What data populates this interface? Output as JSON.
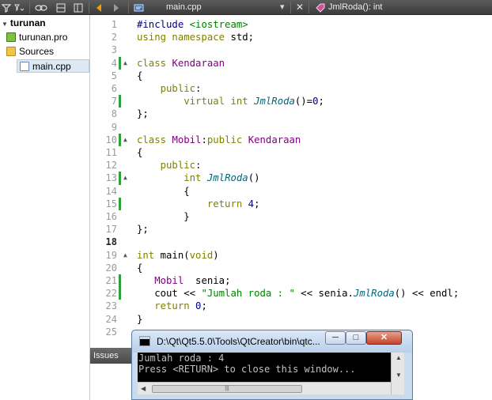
{
  "toolbar": {
    "icons": [
      "filter-icon",
      "link-icon",
      "split-icon",
      "expand-icon",
      "back-arrow-icon",
      "forward-arrow-icon"
    ],
    "file_tab": "main.cpp",
    "symbol_tab": "JmlRoda(): int",
    "close_glyph": "✕",
    "dropdown_glyph": "▾"
  },
  "tree": {
    "project": "turunan",
    "pro_file": "turunan.pro",
    "sources_folder": "Sources",
    "source_file": "main.cpp"
  },
  "editor": {
    "current_line": 18,
    "lines": [
      {
        "n": "1",
        "changed": false,
        "fold": "",
        "html": "<span class='pp'>#include</span> <span class='str'>&lt;iostream&gt;</span>"
      },
      {
        "n": "2",
        "changed": false,
        "fold": "",
        "html": "<span class='kw'>using namespace</span> std;"
      },
      {
        "n": "3",
        "changed": false,
        "fold": "",
        "html": ""
      },
      {
        "n": "4",
        "changed": true,
        "fold": "▲",
        "html": "<span class='kw'>class</span> <span class='ty'>Kendaraan</span>"
      },
      {
        "n": "5",
        "changed": false,
        "fold": "",
        "html": "{"
      },
      {
        "n": "6",
        "changed": false,
        "fold": "",
        "html": "    <span class='kw'>public</span>:"
      },
      {
        "n": "7",
        "changed": true,
        "fold": "",
        "html": "        <span class='kw'>virtual int</span> <span class='fn'>JmlRoda</span>()=<span class='num'>0</span>;"
      },
      {
        "n": "8",
        "changed": false,
        "fold": "",
        "html": "};"
      },
      {
        "n": "9",
        "changed": false,
        "fold": "",
        "html": ""
      },
      {
        "n": "10",
        "changed": true,
        "fold": "▲",
        "html": "<span class='kw'>class</span> <span class='ty'>Mobil</span>:<span class='kw'>public</span> <span class='ty'>Kendaraan</span>"
      },
      {
        "n": "11",
        "changed": false,
        "fold": "",
        "html": "{"
      },
      {
        "n": "12",
        "changed": false,
        "fold": "",
        "html": "    <span class='kw'>public</span>:"
      },
      {
        "n": "13",
        "changed": true,
        "fold": "▲",
        "html": "        <span class='kw'>int</span> <span class='fn'>JmlRoda</span>()"
      },
      {
        "n": "14",
        "changed": false,
        "fold": "",
        "html": "        {"
      },
      {
        "n": "15",
        "changed": true,
        "fold": "",
        "html": "            <span class='kw'>return</span> <span class='num'>4</span>;"
      },
      {
        "n": "16",
        "changed": false,
        "fold": "",
        "html": "        }"
      },
      {
        "n": "17",
        "changed": false,
        "fold": "",
        "html": "};"
      },
      {
        "n": "18",
        "changed": false,
        "fold": "",
        "html": ""
      },
      {
        "n": "19",
        "changed": false,
        "fold": "▲",
        "html": "<span class='kw'>int</span> main(<span class='kw'>void</span>)"
      },
      {
        "n": "20",
        "changed": false,
        "fold": "",
        "html": "{"
      },
      {
        "n": "21",
        "changed": true,
        "fold": "",
        "html": "   <span class='ty'>Mobil</span>  senia;"
      },
      {
        "n": "22",
        "changed": true,
        "fold": "",
        "html": "   cout &lt;&lt; <span class='str'>\"Jumlah roda : \"</span> &lt;&lt; senia.<span class='fn'>JmlRoda</span>() &lt;&lt; endl;"
      },
      {
        "n": "23",
        "changed": false,
        "fold": "",
        "html": "   <span class='kw'>return</span> <span class='num'>0</span>;"
      },
      {
        "n": "24",
        "changed": false,
        "fold": "",
        "html": "}"
      },
      {
        "n": "25",
        "changed": false,
        "fold": "",
        "html": ""
      }
    ]
  },
  "issues": {
    "label": "Issues"
  },
  "console": {
    "title": "D:\\Qt\\Qt5.5.0\\Tools\\QtCreator\\bin\\qtc...",
    "minimize": "─",
    "maximize": "□",
    "close": "✕",
    "output": [
      "Jumlah roda : 4",
      "Press <RETURN> to close this window..."
    ]
  }
}
